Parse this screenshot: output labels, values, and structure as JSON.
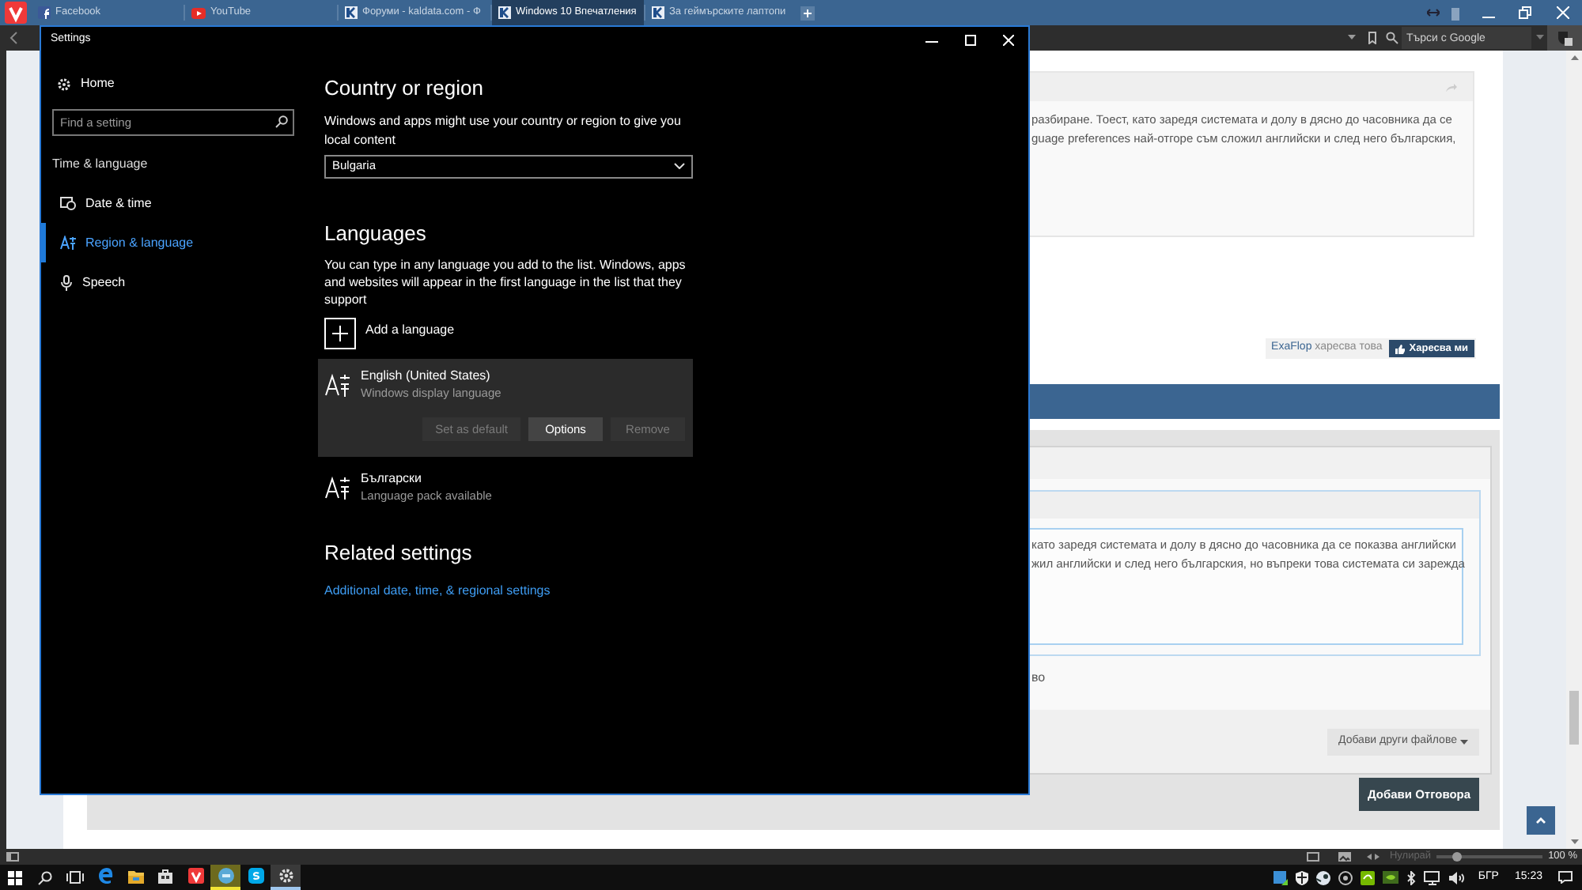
{
  "browser": {
    "tabs": [
      {
        "title": "Facebook",
        "kind": "facebook",
        "selected": false
      },
      {
        "title": "YouTube",
        "kind": "youtube",
        "selected": false
      },
      {
        "title": "Форуми - kaldata.com - Ф",
        "kind": "forum",
        "selected": false
      },
      {
        "title": "Windows 10 Впечатления",
        "kind": "forum",
        "selected": true
      },
      {
        "title": "За геймърските лаптопи",
        "kind": "forum",
        "selected": false
      }
    ],
    "search": {
      "placeholder": "Търси с Google"
    }
  },
  "page": {
    "post_lines": [
      "разбиране. Тоест, като заредя системата и долу в дясно до часовника да се",
      "guage preferences най-отгоре съм сложил английски и след него българския,"
    ],
    "likes": {
      "user": "ExaFlop",
      "text": "харесва това",
      "button": "Харесва ми"
    },
    "editor_lines": [
      "като заредя системата и долу в дясно до часовника да се показва английски",
      "жил английски и след него българския, но въпреки това системата си зарежда"
    ],
    "fragment": "во",
    "attach_button": "Добави други файлове",
    "reply_button": "Добави Отговора"
  },
  "status_bar": {
    "reset": "Нулирай",
    "zoom": {
      "level": 0.2
    },
    "percent": "100 %"
  },
  "settings": {
    "title": "Settings",
    "sidebar": {
      "home": "Home",
      "search": {
        "placeholder": "Find a setting"
      },
      "section": "Time & language",
      "items": [
        {
          "label": "Date & time",
          "kind": "clock",
          "selected": false
        },
        {
          "label": "Region & language",
          "kind": "region",
          "selected": true
        },
        {
          "label": "Speech",
          "kind": "mic",
          "selected": false
        }
      ]
    },
    "country": {
      "heading": "Country or region",
      "description": "Windows and apps might use your country or region to give you local content",
      "value": "Bulgaria"
    },
    "languages": {
      "heading": "Languages",
      "description": "You can type in any language you add to the list. Windows, apps and websites will appear in the first language in the list that they support",
      "add": "Add a language",
      "items": [
        {
          "name": "English (United States)",
          "detail": "Windows display language",
          "expanded": true,
          "buttons": [
            {
              "label": "Set as default",
              "disabled": true
            },
            {
              "label": "Options",
              "disabled": false
            },
            {
              "label": "Remove",
              "disabled": true
            }
          ]
        },
        {
          "name": "Български",
          "detail": "Language pack available",
          "expanded": false
        }
      ]
    },
    "related": {
      "heading": "Related settings",
      "link": "Additional date, time, & regional settings"
    }
  },
  "taskbar": {
    "apps": [
      {
        "kind": "edge",
        "active": false,
        "attention": false
      },
      {
        "kind": "folder",
        "active": false,
        "attention": false
      },
      {
        "kind": "store",
        "active": false,
        "attention": false
      },
      {
        "kind": "vivaldi",
        "active": false,
        "attention": false
      },
      {
        "kind": "chat",
        "active": false,
        "attention": true
      },
      {
        "kind": "skype",
        "active": false,
        "attention": false
      },
      {
        "kind": "gear",
        "active": true,
        "attention": false
      }
    ],
    "language": "БГР",
    "time": "15:23"
  }
}
